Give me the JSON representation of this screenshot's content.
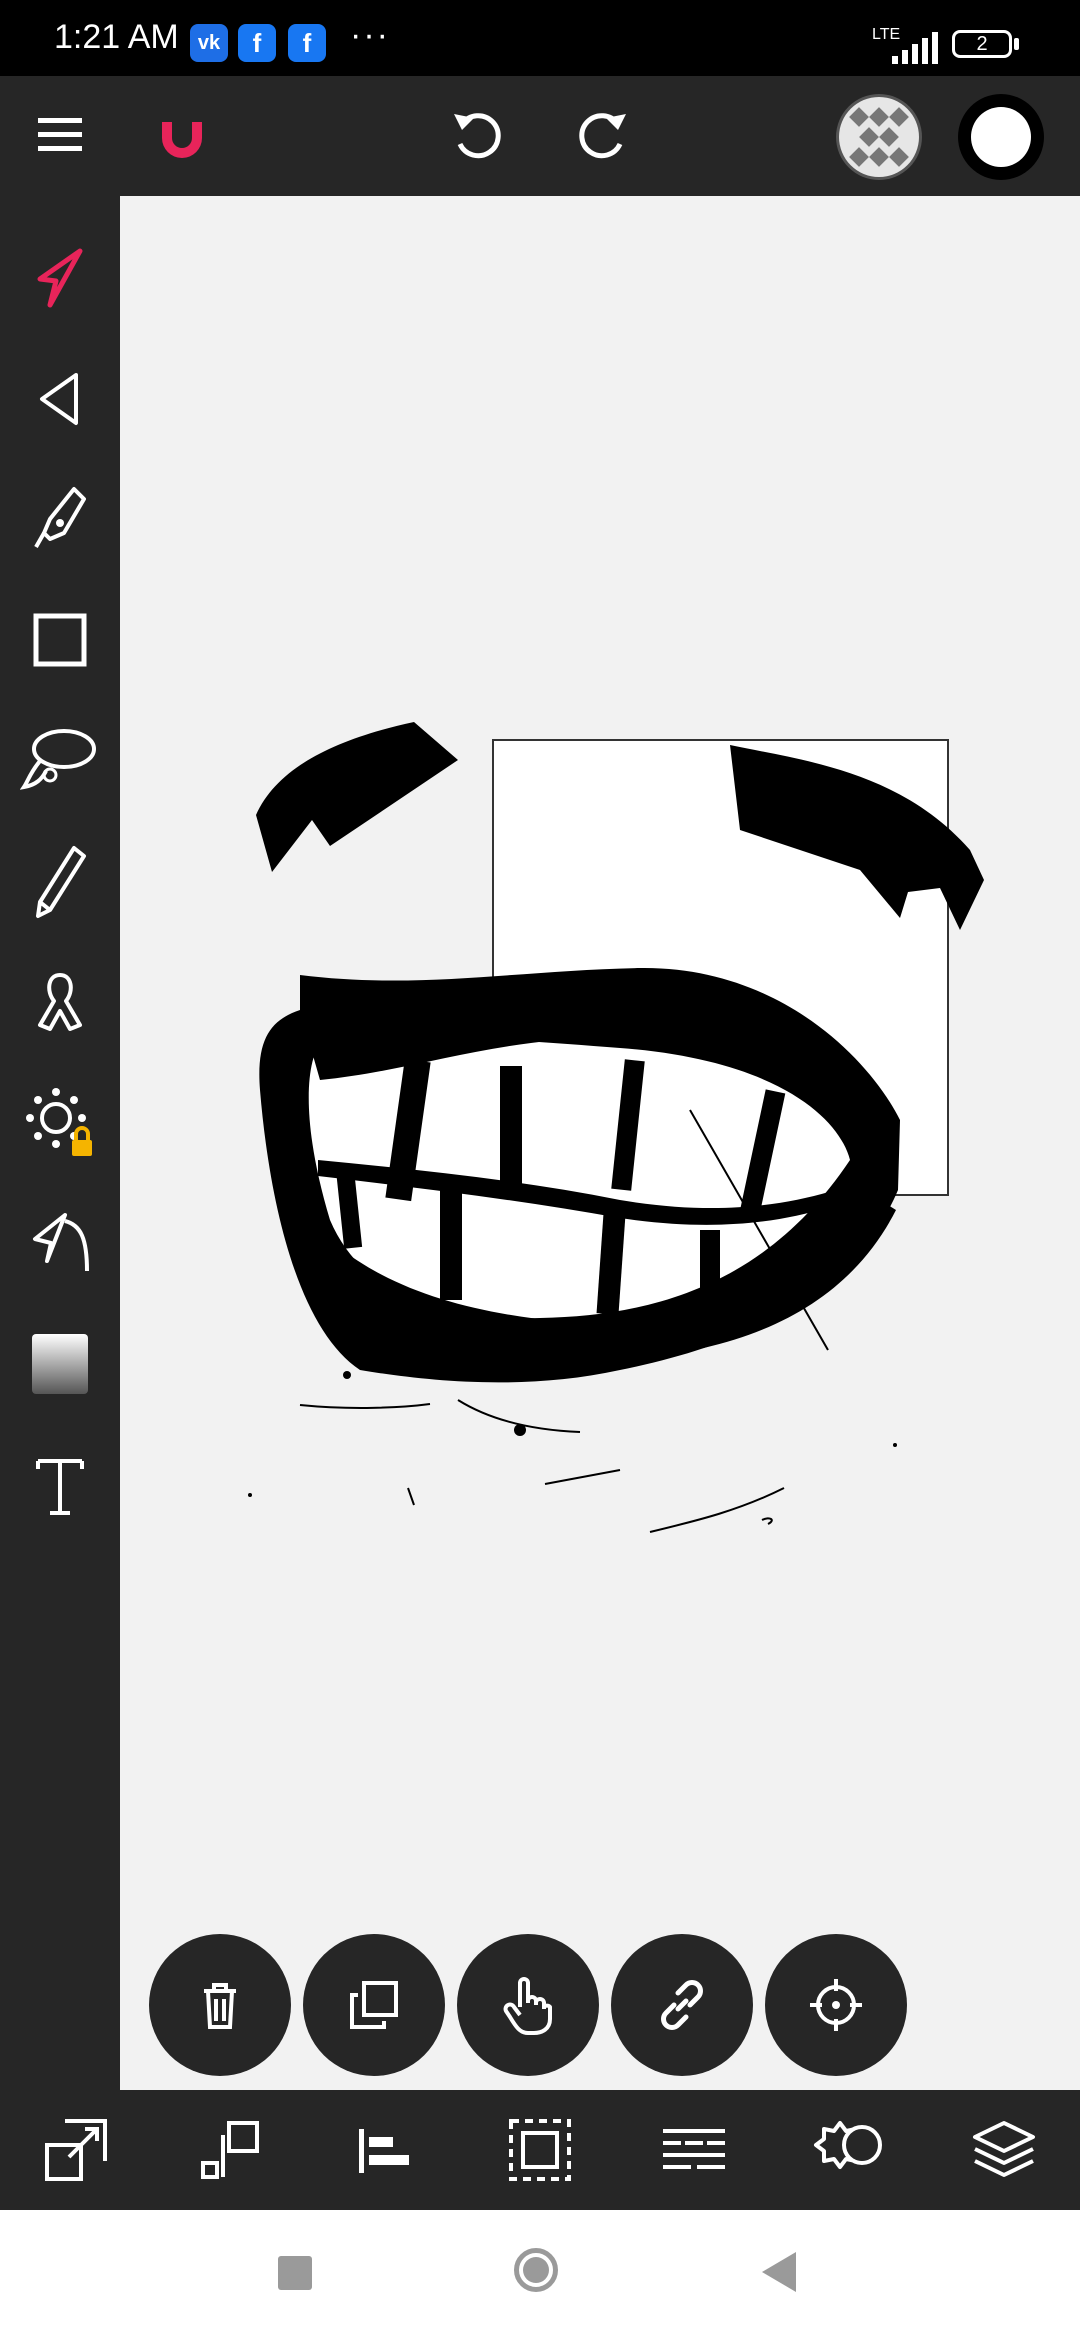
{
  "status_bar": {
    "time": "1:21 AM",
    "network": "LTE",
    "battery": "2",
    "notification_icons": [
      "vk-icon",
      "facebook-icon",
      "facebook-icon",
      "more-dots-icon"
    ]
  },
  "toolbar": {
    "icons": [
      "menu-icon",
      "magnet-icon",
      "undo-icon",
      "redo-icon",
      "transparency-icon",
      "color-swatch-icon"
    ],
    "accent_color": "#e8245a",
    "active_color": "#ffffff"
  },
  "tools": [
    "select-arrow-icon",
    "direct-select-icon",
    "pen-icon",
    "rectangle-icon",
    "lasso-icon",
    "pencil-icon",
    "ribbon-icon",
    "sun-effect-icon",
    "curve-arrow-icon",
    "gradient-icon",
    "text-icon"
  ],
  "selection_actions": [
    "trash-icon",
    "duplicate-icon",
    "hand-pointer-icon",
    "link-icon",
    "target-icon"
  ],
  "bottom_bar": [
    "transform-icon",
    "align-objects-icon",
    "align-left-icon",
    "group-select-icon",
    "distribute-icon",
    "effects-settings-icon",
    "layers-icon"
  ],
  "nav_bar": [
    "recent-apps-icon",
    "home-icon",
    "back-icon"
  ]
}
